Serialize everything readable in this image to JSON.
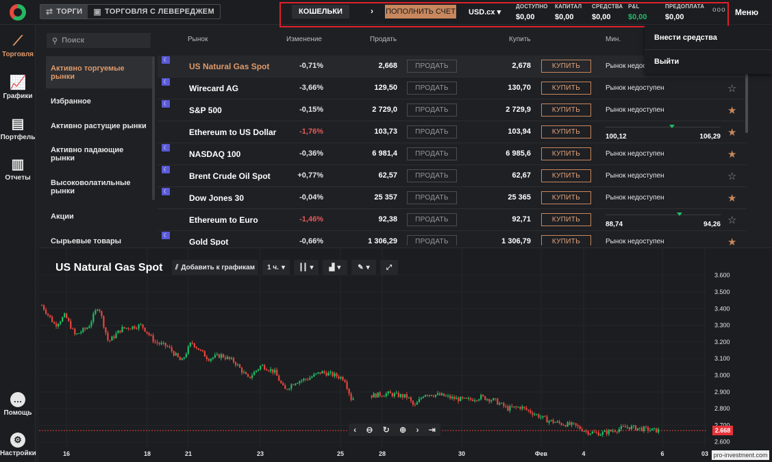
{
  "topbar": {
    "tab_trading": "ТОРГИ",
    "tab_leverage": "ТОРГОВЛЯ С ЛЕВЕРЕДЖЕМ",
    "wallets": "КОШЕЛЬКИ",
    "deposit": "ПОПОЛНИТЬ СЧЕТ",
    "currency": "USD.cx",
    "stats": [
      {
        "label": "ДОСТУПНО",
        "value": "$0,00"
      },
      {
        "label": "КАПИТАЛ",
        "value": "$0,00"
      },
      {
        "label": "СРЕДСТВА",
        "value": "$0,00"
      },
      {
        "label": "P&L",
        "value": "$0,00"
      },
      {
        "label": "ПРЕДОПЛАТА",
        "value": "$0,00"
      }
    ],
    "more": "ooo",
    "menu": "Меню"
  },
  "dropdown": {
    "items": [
      "Внести средства",
      "Выйти"
    ]
  },
  "leftnav": {
    "items": [
      "Торговля",
      "Графики",
      "Портфель",
      "Отчеты"
    ],
    "bottom": [
      "Помощь",
      "Настройки"
    ]
  },
  "sidebar": {
    "search_placeholder": "Поиск",
    "categories": [
      "Активно торгуемые рынки",
      "Избранное",
      "Активно растущие рынки",
      "Активно падающие рынки",
      "Высоковолатильные рынки",
      "Акции",
      "Сырьевые товары"
    ]
  },
  "table": {
    "headers": [
      "Рынок",
      "Изменение",
      "Продать",
      "Купить",
      "Мин."
    ],
    "sell_label": "ПРОДАТЬ",
    "buy_label": "КУПИТЬ",
    "unavailable": "Рынок недоступен",
    "rows": [
      {
        "name": "US Natural Gas Spot",
        "change": "-0,71%",
        "sell": "2,668",
        "buy": "2,678",
        "min": "Рынок недос",
        "starred": false,
        "negative_red": false,
        "flag": true
      },
      {
        "name": "Wirecard AG",
        "change": "-3,66%",
        "sell": "129,50",
        "buy": "130,70",
        "min": "Рынок недоступен",
        "starred": false,
        "negative_red": false,
        "flag": true
      },
      {
        "name": "S&P 500",
        "change": "-0,15%",
        "sell": "2 729,0",
        "buy": "2 729,9",
        "min": "Рынок недоступен",
        "starred": true,
        "negative_red": false,
        "flag": true
      },
      {
        "name": "Ethereum to US Dollar",
        "change": "-1,76%",
        "sell": "103,73",
        "buy": "103,94",
        "range_low": "100,12",
        "range_high": "106,29",
        "range_pos": 0.58,
        "starred": true,
        "negative_red": true,
        "flag": false
      },
      {
        "name": "NASDAQ 100",
        "change": "-0,36%",
        "sell": "6 981,4",
        "buy": "6 985,6",
        "min": "Рынок недоступен",
        "starred": true,
        "negative_red": false,
        "flag": true
      },
      {
        "name": "Brent Crude Oil Spot",
        "change": "+0,77%",
        "sell": "62,57",
        "buy": "62,67",
        "min": "Рынок недоступен",
        "starred": false,
        "negative_red": false,
        "flag": true
      },
      {
        "name": "Dow Jones 30",
        "change": "-0,04%",
        "sell": "25 357",
        "buy": "25 365",
        "min": "Рынок недоступен",
        "starred": true,
        "negative_red": false,
        "flag": true
      },
      {
        "name": "Ethereum to Euro",
        "change": "-1,46%",
        "sell": "92,38",
        "buy": "92,71",
        "range_low": "88,74",
        "range_high": "94,26",
        "range_pos": 0.64,
        "starred": false,
        "negative_red": true,
        "flag": false
      },
      {
        "name": "Gold Spot",
        "change": "-0,66%",
        "sell": "1 306,29",
        "buy": "1 306,79",
        "min": "Рынок недоступен",
        "starred": true,
        "negative_red": false,
        "flag": true
      }
    ]
  },
  "chart": {
    "title": "US Natural Gas Spot",
    "add_to_charts": "Добавить к графикам",
    "interval": "1 ч.",
    "current_price": "2.668",
    "watermark": "pro-investment.com",
    "colors": {
      "up": "#1fbf66",
      "down": "#e8473f"
    }
  },
  "chart_data": {
    "type": "candlestick",
    "y_ticks": [
      "3.600",
      "3.500",
      "3.400",
      "3.300",
      "3.200",
      "3.100",
      "3.000",
      "2.900",
      "2.800",
      "2.700",
      "2.600"
    ],
    "x_ticks": [
      "16",
      "18",
      "21",
      "23",
      "25",
      "28",
      "30",
      "Фев",
      "4",
      "6",
      "03"
    ],
    "ylim": [
      2.57,
      3.64
    ],
    "current": 2.668,
    "path": [
      [
        0,
        3.42
      ],
      [
        0.02,
        3.3
      ],
      [
        0.035,
        3.36
      ],
      [
        0.05,
        3.24
      ],
      [
        0.07,
        3.29
      ],
      [
        0.085,
        3.42
      ],
      [
        0.1,
        3.2
      ],
      [
        0.12,
        3.28
      ],
      [
        0.15,
        3.3
      ],
      [
        0.17,
        3.2
      ],
      [
        0.19,
        3.17
      ],
      [
        0.21,
        3.08
      ],
      [
        0.225,
        3.2
      ],
      [
        0.25,
        3.1
      ],
      [
        0.27,
        3.12
      ],
      [
        0.29,
        3.08
      ],
      [
        0.31,
        2.98
      ],
      [
        0.33,
        3.06
      ],
      [
        0.35,
        3.02
      ],
      [
        0.365,
        2.91
      ],
      [
        0.38,
        2.96
      ],
      [
        0.4,
        2.98
      ],
      [
        0.42,
        3.02
      ],
      [
        0.44,
        3.0
      ],
      [
        0.455,
        2.98
      ],
      [
        0.465,
        2.86
      ],
      [
        0.48,
        2.87
      ],
      [
        0.5,
        2.88
      ],
      [
        0.52,
        2.89
      ],
      [
        0.55,
        2.87
      ],
      [
        0.56,
        2.81
      ],
      [
        0.575,
        2.89
      ],
      [
        0.6,
        2.88
      ],
      [
        0.62,
        2.86
      ],
      [
        0.64,
        2.85
      ],
      [
        0.66,
        2.87
      ],
      [
        0.68,
        2.85
      ],
      [
        0.7,
        2.8
      ],
      [
        0.72,
        2.81
      ],
      [
        0.74,
        2.77
      ],
      [
        0.76,
        2.73
      ],
      [
        0.78,
        2.71
      ],
      [
        0.8,
        2.7
      ],
      [
        0.82,
        2.66
      ],
      [
        0.84,
        2.65
      ],
      [
        0.86,
        2.67
      ],
      [
        0.88,
        2.69
      ],
      [
        0.9,
        2.68
      ],
      [
        0.92,
        2.67
      ],
      [
        0.93,
        2.668
      ]
    ]
  }
}
